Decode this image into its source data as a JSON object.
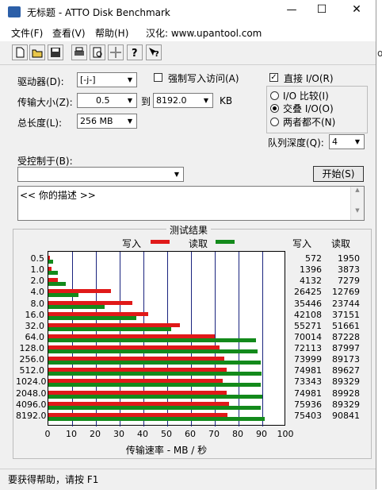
{
  "window": {
    "title": "无标题 - ATTO Disk Benchmark",
    "controls": {
      "minimize": "—",
      "maximize": "☐",
      "close": "✕"
    }
  },
  "menu": [
    "文件(F)",
    "查看(V)",
    "帮助(H)",
    "汉化: www.upantool.com"
  ],
  "toolbar_icons": [
    "new-file-icon",
    "open-folder-icon",
    "save-icon",
    "print-icon",
    "print-preview-icon",
    "move-icon",
    "help-icon",
    "context-help-icon"
  ],
  "settings": {
    "drive_label": "驱动器(D):",
    "drive_value": "[-j-]",
    "transfer_label": "传输大小(Z):",
    "transfer_from": "0.5",
    "to_label": "到",
    "transfer_to": "8192.0",
    "kb_label": "KB",
    "total_label": "总长度(L):",
    "total_value": "256 MB",
    "force_write_label": "强制写入访问(A)",
    "direct_io_label": "直接 I/O(R)",
    "direct_io_checked": true,
    "io_compare_label": "I/O 比较(I)",
    "overlap_io_label": "交叠 I/O(O)",
    "neither_label": "两者都不(N)",
    "selected_mode": "overlap",
    "queue_label": "队列深度(Q):",
    "queue_value": "4",
    "controlled_label": "受控制于(B):",
    "controlled_value": "",
    "start_button": "开始(S)",
    "description": "<< 你的描述 >>"
  },
  "results": {
    "group_title": "测试结果",
    "write_legend": "写入",
    "read_legend": "读取",
    "write_header": "写入",
    "read_header": "读取",
    "x_axis_label": "传输速率 - MB / 秒",
    "colors": {
      "write": "#e01919",
      "read": "#138a1b"
    }
  },
  "chart_data": {
    "type": "bar",
    "orientation": "horizontal",
    "categories": [
      "0.5",
      "1.0",
      "2.0",
      "4.0",
      "8.0",
      "16.0",
      "32.0",
      "64.0",
      "128.0",
      "256.0",
      "512.0",
      "1024.0",
      "2048.0",
      "4096.0",
      "8192.0"
    ],
    "series": [
      {
        "name": "写入",
        "values": [
          572,
          1396,
          4132,
          26425,
          35446,
          42108,
          55271,
          70014,
          72113,
          73999,
          74981,
          73343,
          74981,
          75936,
          75403
        ]
      },
      {
        "name": "读取",
        "values": [
          1950,
          3873,
          7279,
          12769,
          23744,
          37151,
          51661,
          87228,
          87997,
          89173,
          89627,
          89329,
          89928,
          89329,
          90841
        ]
      }
    ],
    "xlim": [
      0,
      100
    ],
    "xticks": [
      "0",
      "10",
      "20",
      "30",
      "40",
      "50",
      "60",
      "70",
      "80",
      "90",
      "100"
    ],
    "xlabel": "传输速率 - MB / 秒",
    "grid": true
  },
  "status_bar": "要获得帮助，请按 F1"
}
